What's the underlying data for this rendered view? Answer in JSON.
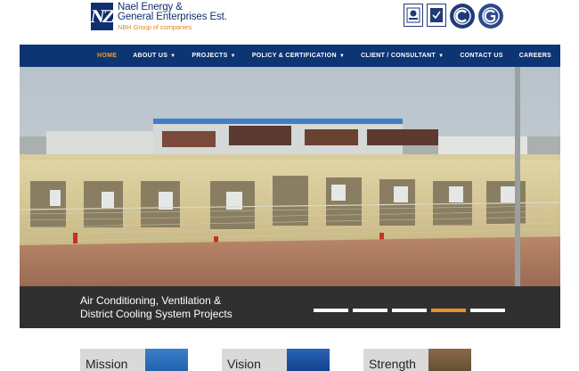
{
  "brand": {
    "logo_text": "NZ",
    "company_line1": "Nael Energy &",
    "company_line2": "General Enterprises Est.",
    "company_sub": "NBH Group of companies"
  },
  "certifications": [
    {
      "icon": "iso-cert-icon"
    },
    {
      "icon": "quality-cert-icon"
    },
    {
      "icon": "cert-seal-icon"
    },
    {
      "icon": "cert-seal-icon"
    }
  ],
  "nav": {
    "items": [
      {
        "label": "HOME",
        "dropdown": false,
        "active": true
      },
      {
        "label": "ABOUT US",
        "dropdown": true,
        "active": false
      },
      {
        "label": "PROJECTS",
        "dropdown": true,
        "active": false
      },
      {
        "label": "POLICY & CERTIFICATION",
        "dropdown": true,
        "active": false
      },
      {
        "label": "CLIENT / CONSULTANT",
        "dropdown": true,
        "active": false
      },
      {
        "label": "CONTACT US",
        "dropdown": false,
        "active": false
      },
      {
        "label": "CAREERS",
        "dropdown": false,
        "active": false
      }
    ],
    "caret": "▼"
  },
  "hero": {
    "caption_line1": "Air Conditioning, Ventilation &",
    "caption_line2": "District Cooling System Projects",
    "slide_count": 5,
    "active_slide": 4
  },
  "cards": [
    {
      "label": "Mission"
    },
    {
      "label": "Vision"
    },
    {
      "label": "Strength"
    }
  ],
  "colors": {
    "nav_bg": "#0d3573",
    "accent": "#e8922c",
    "caption_bg": "#303030"
  }
}
